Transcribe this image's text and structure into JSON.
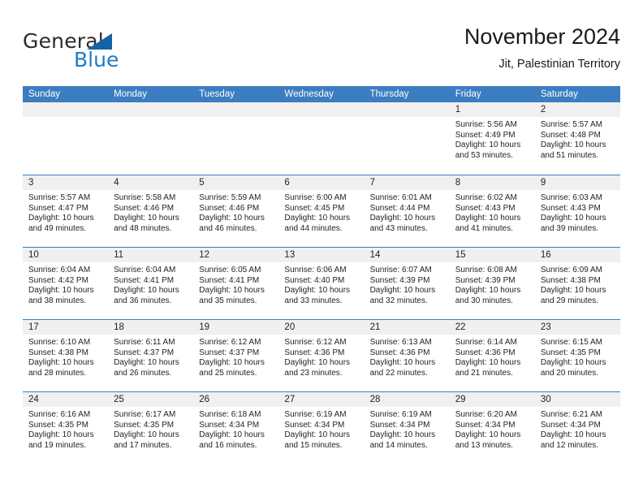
{
  "brand": {
    "name_part1": "General",
    "name_part2": "Blue",
    "triangle_color": "#1463a5",
    "blue_color": "#1f7cc4"
  },
  "header": {
    "title": "November 2024",
    "subtitle": "Jit, Palestinian Territory"
  },
  "calendar": {
    "header_bg": "#3b7dc0",
    "daynum_bg": "#f0f0f0",
    "weekdays": [
      "Sunday",
      "Monday",
      "Tuesday",
      "Wednesday",
      "Thursday",
      "Friday",
      "Saturday"
    ],
    "weeks": [
      [
        {
          "day": "",
          "sunrise": "",
          "sunset": "",
          "daylight_line1": "",
          "daylight_line2": ""
        },
        {
          "day": "",
          "sunrise": "",
          "sunset": "",
          "daylight_line1": "",
          "daylight_line2": ""
        },
        {
          "day": "",
          "sunrise": "",
          "sunset": "",
          "daylight_line1": "",
          "daylight_line2": ""
        },
        {
          "day": "",
          "sunrise": "",
          "sunset": "",
          "daylight_line1": "",
          "daylight_line2": ""
        },
        {
          "day": "",
          "sunrise": "",
          "sunset": "",
          "daylight_line1": "",
          "daylight_line2": ""
        },
        {
          "day": "1",
          "sunrise": "Sunrise: 5:56 AM",
          "sunset": "Sunset: 4:49 PM",
          "daylight_line1": "Daylight: 10 hours",
          "daylight_line2": "and 53 minutes."
        },
        {
          "day": "2",
          "sunrise": "Sunrise: 5:57 AM",
          "sunset": "Sunset: 4:48 PM",
          "daylight_line1": "Daylight: 10 hours",
          "daylight_line2": "and 51 minutes."
        }
      ],
      [
        {
          "day": "3",
          "sunrise": "Sunrise: 5:57 AM",
          "sunset": "Sunset: 4:47 PM",
          "daylight_line1": "Daylight: 10 hours",
          "daylight_line2": "and 49 minutes."
        },
        {
          "day": "4",
          "sunrise": "Sunrise: 5:58 AM",
          "sunset": "Sunset: 4:46 PM",
          "daylight_line1": "Daylight: 10 hours",
          "daylight_line2": "and 48 minutes."
        },
        {
          "day": "5",
          "sunrise": "Sunrise: 5:59 AM",
          "sunset": "Sunset: 4:46 PM",
          "daylight_line1": "Daylight: 10 hours",
          "daylight_line2": "and 46 minutes."
        },
        {
          "day": "6",
          "sunrise": "Sunrise: 6:00 AM",
          "sunset": "Sunset: 4:45 PM",
          "daylight_line1": "Daylight: 10 hours",
          "daylight_line2": "and 44 minutes."
        },
        {
          "day": "7",
          "sunrise": "Sunrise: 6:01 AM",
          "sunset": "Sunset: 4:44 PM",
          "daylight_line1": "Daylight: 10 hours",
          "daylight_line2": "and 43 minutes."
        },
        {
          "day": "8",
          "sunrise": "Sunrise: 6:02 AM",
          "sunset": "Sunset: 4:43 PM",
          "daylight_line1": "Daylight: 10 hours",
          "daylight_line2": "and 41 minutes."
        },
        {
          "day": "9",
          "sunrise": "Sunrise: 6:03 AM",
          "sunset": "Sunset: 4:43 PM",
          "daylight_line1": "Daylight: 10 hours",
          "daylight_line2": "and 39 minutes."
        }
      ],
      [
        {
          "day": "10",
          "sunrise": "Sunrise: 6:04 AM",
          "sunset": "Sunset: 4:42 PM",
          "daylight_line1": "Daylight: 10 hours",
          "daylight_line2": "and 38 minutes."
        },
        {
          "day": "11",
          "sunrise": "Sunrise: 6:04 AM",
          "sunset": "Sunset: 4:41 PM",
          "daylight_line1": "Daylight: 10 hours",
          "daylight_line2": "and 36 minutes."
        },
        {
          "day": "12",
          "sunrise": "Sunrise: 6:05 AM",
          "sunset": "Sunset: 4:41 PM",
          "daylight_line1": "Daylight: 10 hours",
          "daylight_line2": "and 35 minutes."
        },
        {
          "day": "13",
          "sunrise": "Sunrise: 6:06 AM",
          "sunset": "Sunset: 4:40 PM",
          "daylight_line1": "Daylight: 10 hours",
          "daylight_line2": "and 33 minutes."
        },
        {
          "day": "14",
          "sunrise": "Sunrise: 6:07 AM",
          "sunset": "Sunset: 4:39 PM",
          "daylight_line1": "Daylight: 10 hours",
          "daylight_line2": "and 32 minutes."
        },
        {
          "day": "15",
          "sunrise": "Sunrise: 6:08 AM",
          "sunset": "Sunset: 4:39 PM",
          "daylight_line1": "Daylight: 10 hours",
          "daylight_line2": "and 30 minutes."
        },
        {
          "day": "16",
          "sunrise": "Sunrise: 6:09 AM",
          "sunset": "Sunset: 4:38 PM",
          "daylight_line1": "Daylight: 10 hours",
          "daylight_line2": "and 29 minutes."
        }
      ],
      [
        {
          "day": "17",
          "sunrise": "Sunrise: 6:10 AM",
          "sunset": "Sunset: 4:38 PM",
          "daylight_line1": "Daylight: 10 hours",
          "daylight_line2": "and 28 minutes."
        },
        {
          "day": "18",
          "sunrise": "Sunrise: 6:11 AM",
          "sunset": "Sunset: 4:37 PM",
          "daylight_line1": "Daylight: 10 hours",
          "daylight_line2": "and 26 minutes."
        },
        {
          "day": "19",
          "sunrise": "Sunrise: 6:12 AM",
          "sunset": "Sunset: 4:37 PM",
          "daylight_line1": "Daylight: 10 hours",
          "daylight_line2": "and 25 minutes."
        },
        {
          "day": "20",
          "sunrise": "Sunrise: 6:12 AM",
          "sunset": "Sunset: 4:36 PM",
          "daylight_line1": "Daylight: 10 hours",
          "daylight_line2": "and 23 minutes."
        },
        {
          "day": "21",
          "sunrise": "Sunrise: 6:13 AM",
          "sunset": "Sunset: 4:36 PM",
          "daylight_line1": "Daylight: 10 hours",
          "daylight_line2": "and 22 minutes."
        },
        {
          "day": "22",
          "sunrise": "Sunrise: 6:14 AM",
          "sunset": "Sunset: 4:36 PM",
          "daylight_line1": "Daylight: 10 hours",
          "daylight_line2": "and 21 minutes."
        },
        {
          "day": "23",
          "sunrise": "Sunrise: 6:15 AM",
          "sunset": "Sunset: 4:35 PM",
          "daylight_line1": "Daylight: 10 hours",
          "daylight_line2": "and 20 minutes."
        }
      ],
      [
        {
          "day": "24",
          "sunrise": "Sunrise: 6:16 AM",
          "sunset": "Sunset: 4:35 PM",
          "daylight_line1": "Daylight: 10 hours",
          "daylight_line2": "and 19 minutes."
        },
        {
          "day": "25",
          "sunrise": "Sunrise: 6:17 AM",
          "sunset": "Sunset: 4:35 PM",
          "daylight_line1": "Daylight: 10 hours",
          "daylight_line2": "and 17 minutes."
        },
        {
          "day": "26",
          "sunrise": "Sunrise: 6:18 AM",
          "sunset": "Sunset: 4:34 PM",
          "daylight_line1": "Daylight: 10 hours",
          "daylight_line2": "and 16 minutes."
        },
        {
          "day": "27",
          "sunrise": "Sunrise: 6:19 AM",
          "sunset": "Sunset: 4:34 PM",
          "daylight_line1": "Daylight: 10 hours",
          "daylight_line2": "and 15 minutes."
        },
        {
          "day": "28",
          "sunrise": "Sunrise: 6:19 AM",
          "sunset": "Sunset: 4:34 PM",
          "daylight_line1": "Daylight: 10 hours",
          "daylight_line2": "and 14 minutes."
        },
        {
          "day": "29",
          "sunrise": "Sunrise: 6:20 AM",
          "sunset": "Sunset: 4:34 PM",
          "daylight_line1": "Daylight: 10 hours",
          "daylight_line2": "and 13 minutes."
        },
        {
          "day": "30",
          "sunrise": "Sunrise: 6:21 AM",
          "sunset": "Sunset: 4:34 PM",
          "daylight_line1": "Daylight: 10 hours",
          "daylight_line2": "and 12 minutes."
        }
      ]
    ]
  }
}
